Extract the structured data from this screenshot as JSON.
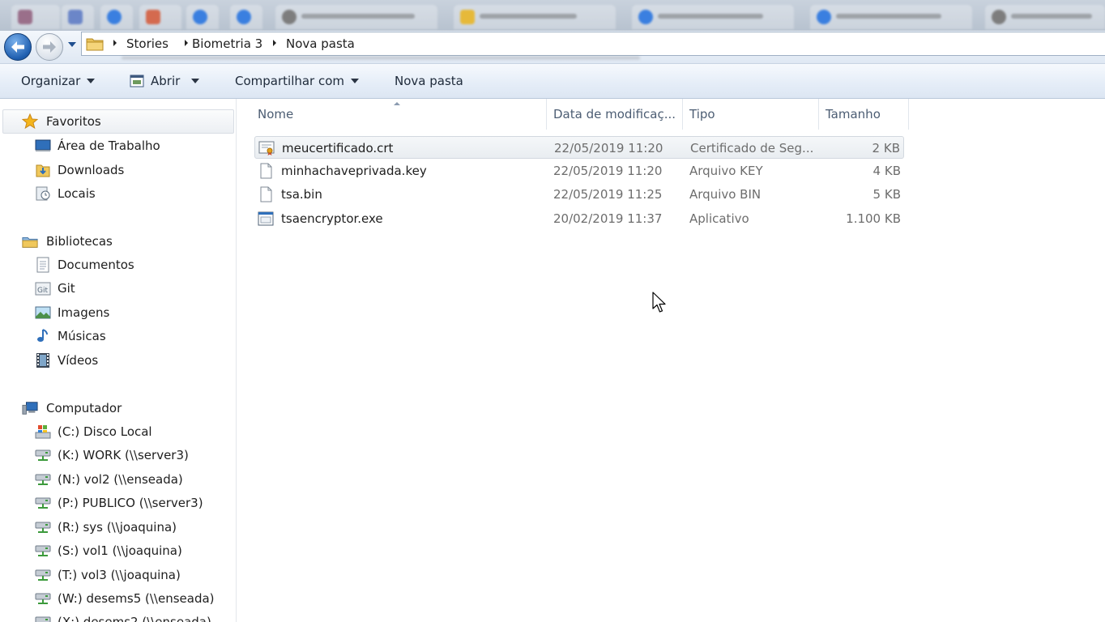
{
  "breadcrumb": {
    "items": [
      "Stories",
      "Biometria 3",
      "Nova pasta"
    ]
  },
  "toolbar": {
    "organize": "Organizar",
    "open": "Abrir",
    "share": "Compartilhar com",
    "new_folder": "Nova pasta"
  },
  "nav": {
    "favorites": {
      "title": "Favoritos",
      "items": [
        "Área de Trabalho",
        "Downloads",
        "Locais"
      ]
    },
    "libraries": {
      "title": "Bibliotecas",
      "items": [
        "Documentos",
        "Git",
        "Imagens",
        "Músicas",
        "Vídeos"
      ]
    },
    "computer": {
      "title": "Computador",
      "items": [
        "(C:) Disco Local",
        "(K:) WORK (\\\\server3)",
        "(N:) vol2 (\\\\enseada)",
        "(P:) PUBLICO (\\\\server3)",
        "(R:) sys (\\\\joaquina)",
        "(S:) vol1 (\\\\joaquina)",
        "(T:) vol3 (\\\\joaquina)",
        "(W:) desems5 (\\\\enseada)",
        "(X:) desems2 (\\\\enseada)"
      ]
    }
  },
  "columns": {
    "name": "Nome",
    "modified": "Data de modificaç...",
    "type": "Tipo",
    "size": "Tamanho"
  },
  "files": [
    {
      "name": "meucertificado.crt",
      "modified": "22/05/2019 11:20",
      "type": "Certificado de Seg...",
      "size": "2 KB",
      "icon": "certificate-icon",
      "selected": true
    },
    {
      "name": "minhachaveprivada.key",
      "modified": "22/05/2019 11:20",
      "type": "Arquivo KEY",
      "size": "4 KB",
      "icon": "blank-file-icon",
      "selected": false
    },
    {
      "name": "tsa.bin",
      "modified": "22/05/2019 11:25",
      "type": "Arquivo BIN",
      "size": "5 KB",
      "icon": "blank-file-icon",
      "selected": false
    },
    {
      "name": "tsaencryptor.exe",
      "modified": "20/02/2019 11:37",
      "type": "Aplicativo",
      "size": "1.100 KB",
      "icon": "application-icon",
      "selected": false
    }
  ],
  "colors": {
    "accent_blue": "#1f5fb0",
    "selection_border": "#d2d8df",
    "column_header_text": "#4c5d73"
  }
}
